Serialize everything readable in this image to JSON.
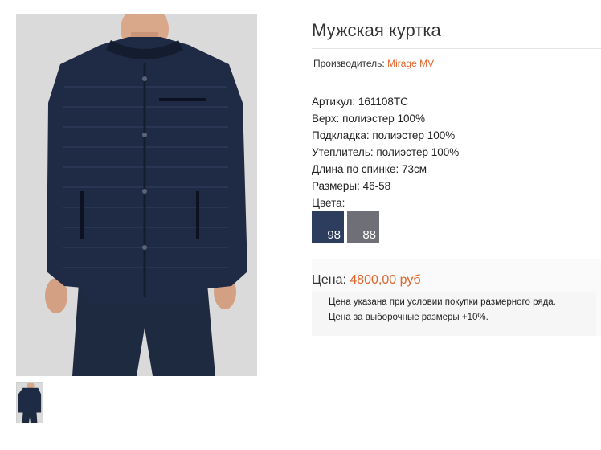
{
  "product": {
    "title": "Мужская куртка",
    "maker_label": "Производитель: ",
    "maker_link": "Mirage MV",
    "specs": [
      "Артикул: 161108ТС",
      "Верх: полиэстер 100%",
      "Подкладка: полиэстер 100%",
      "Утеплитель: полиэстер 100%",
      "Длина по спинке: 73см",
      "Размеры: 46-58"
    ],
    "colors_label": "Цвета:",
    "colors": [
      {
        "code": "98",
        "hex": "#2c3d5e"
      },
      {
        "code": "88",
        "hex": "#6f6f78"
      }
    ],
    "price_label": "Цена: ",
    "price_value": "4800,00 руб",
    "notes": [
      "Цена указана при условии покупки размерного ряда.",
      "Цена за выборочные размеры +10%."
    ]
  },
  "images": {
    "main": "jacket-photo",
    "thumbnail": "jacket-thumbnail"
  },
  "theme": {
    "accent": "#e0662e",
    "jacket": "#1f2a44"
  }
}
